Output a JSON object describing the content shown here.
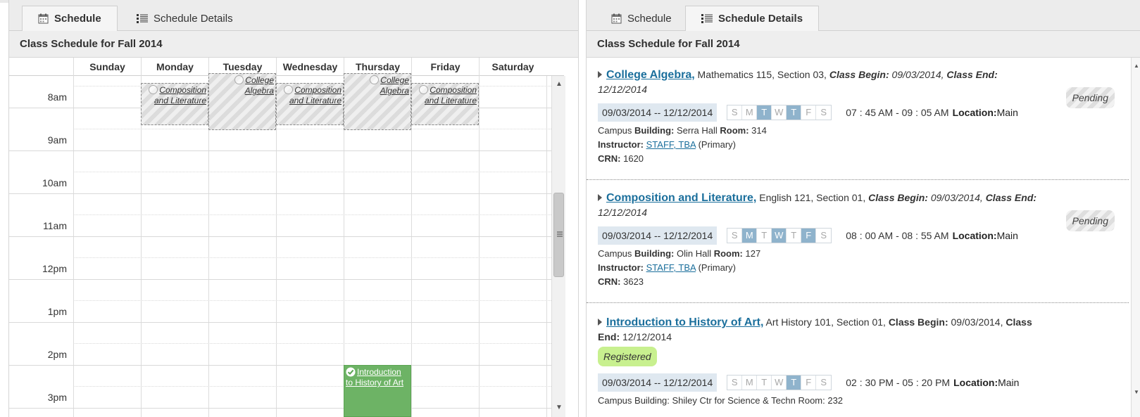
{
  "left": {
    "tabs": [
      {
        "label": "Schedule",
        "icon": "calendar-icon",
        "active": true
      },
      {
        "label": "Schedule Details",
        "icon": "list-icon",
        "active": false
      }
    ],
    "header": "Class Schedule for Fall 2014",
    "days": [
      "Sunday",
      "Monday",
      "Tuesday",
      "Wednesday",
      "Thursday",
      "Friday",
      "Saturday"
    ],
    "hours": [
      "8am",
      "9am",
      "10am",
      "11am",
      "12pm",
      "1pm",
      "2pm",
      "3pm"
    ],
    "events": [
      {
        "day": "Monday",
        "title": "Composition and Literature",
        "status": "pending"
      },
      {
        "day": "Tuesday",
        "title": "College Algebra",
        "status": "pending"
      },
      {
        "day": "Wednesday",
        "title": "Composition and Literature",
        "status": "pending"
      },
      {
        "day": "Thursday",
        "title": "College Algebra",
        "status": "pending"
      },
      {
        "day": "Friday",
        "title": "Composition and Literature",
        "status": "pending"
      },
      {
        "day": "Thursday",
        "title": "Introduction to History of Art",
        "status": "registered"
      }
    ]
  },
  "right": {
    "tabs": [
      {
        "label": "Schedule",
        "icon": "calendar-icon",
        "active": false
      },
      {
        "label": "Schedule Details",
        "icon": "list-icon",
        "active": true
      }
    ],
    "header": "Class Schedule for Fall 2014",
    "day_letters": [
      "S",
      "M",
      "T",
      "W",
      "T",
      "F",
      "S"
    ],
    "courses": [
      {
        "name": "College Algebra,",
        "subject": " Mathematics 115, Section 03, ",
        "begin_label": "Class Begin:",
        "begin": " 09/03/2014, ",
        "end_label": "Class End:",
        "end": " 12/12/2014",
        "status": "Pending",
        "date_range": "09/03/2014 -- 12/12/2014",
        "days_on": [
          false,
          false,
          true,
          false,
          true,
          false,
          false
        ],
        "time": "07 : 45 AM - 09 : 05 AM",
        "location_label": "Location:",
        "location": " Main",
        "building_prefix": "Campus ",
        "building_label": "Building:",
        "building": " Serra Hall ",
        "room_label": "Room:",
        "room": " 314",
        "instructor_label": "Instructor:",
        "instructor": "STAFF, TBA",
        "instructor_role": " (Primary)",
        "crn_label": "CRN:",
        "crn": " 1620"
      },
      {
        "name": "Composition and Literature,",
        "subject": " English 121, Section 01, ",
        "begin_label": "Class Begin:",
        "begin": " 09/03/2014, ",
        "end_label": "Class End:",
        "end": " 12/12/2014",
        "status": "Pending",
        "date_range": "09/03/2014 -- 12/12/2014",
        "days_on": [
          false,
          true,
          false,
          true,
          false,
          true,
          false
        ],
        "time": "08 : 00 AM - 08 : 55 AM",
        "location_label": "Location:",
        "location": " Main",
        "building_prefix": "Campus ",
        "building_label": "Building:",
        "building": " Olin Hall ",
        "room_label": "Room:",
        "room": " 127",
        "instructor_label": "Instructor:",
        "instructor": "STAFF, TBA",
        "instructor_role": " (Primary)",
        "crn_label": "CRN:",
        "crn": " 3623"
      },
      {
        "name": "Introduction to History of Art,",
        "subject": " Art History 101, Section 01, ",
        "begin_label": "Class Begin:",
        "begin": " 09/03/2014,",
        "end_label": "Class End:",
        "end": " 12/12/2014",
        "status": "Registered",
        "date_range": "09/03/2014 -- 12/12/2014",
        "days_on": [
          false,
          false,
          false,
          false,
          true,
          false,
          false
        ],
        "time": "02 : 30 PM - 05 : 20 PM",
        "location_label": "Location:",
        "location": " Main",
        "building_partial": "Campus Building: Shiley Ctr for Science & Techn Room: 232"
      }
    ]
  }
}
